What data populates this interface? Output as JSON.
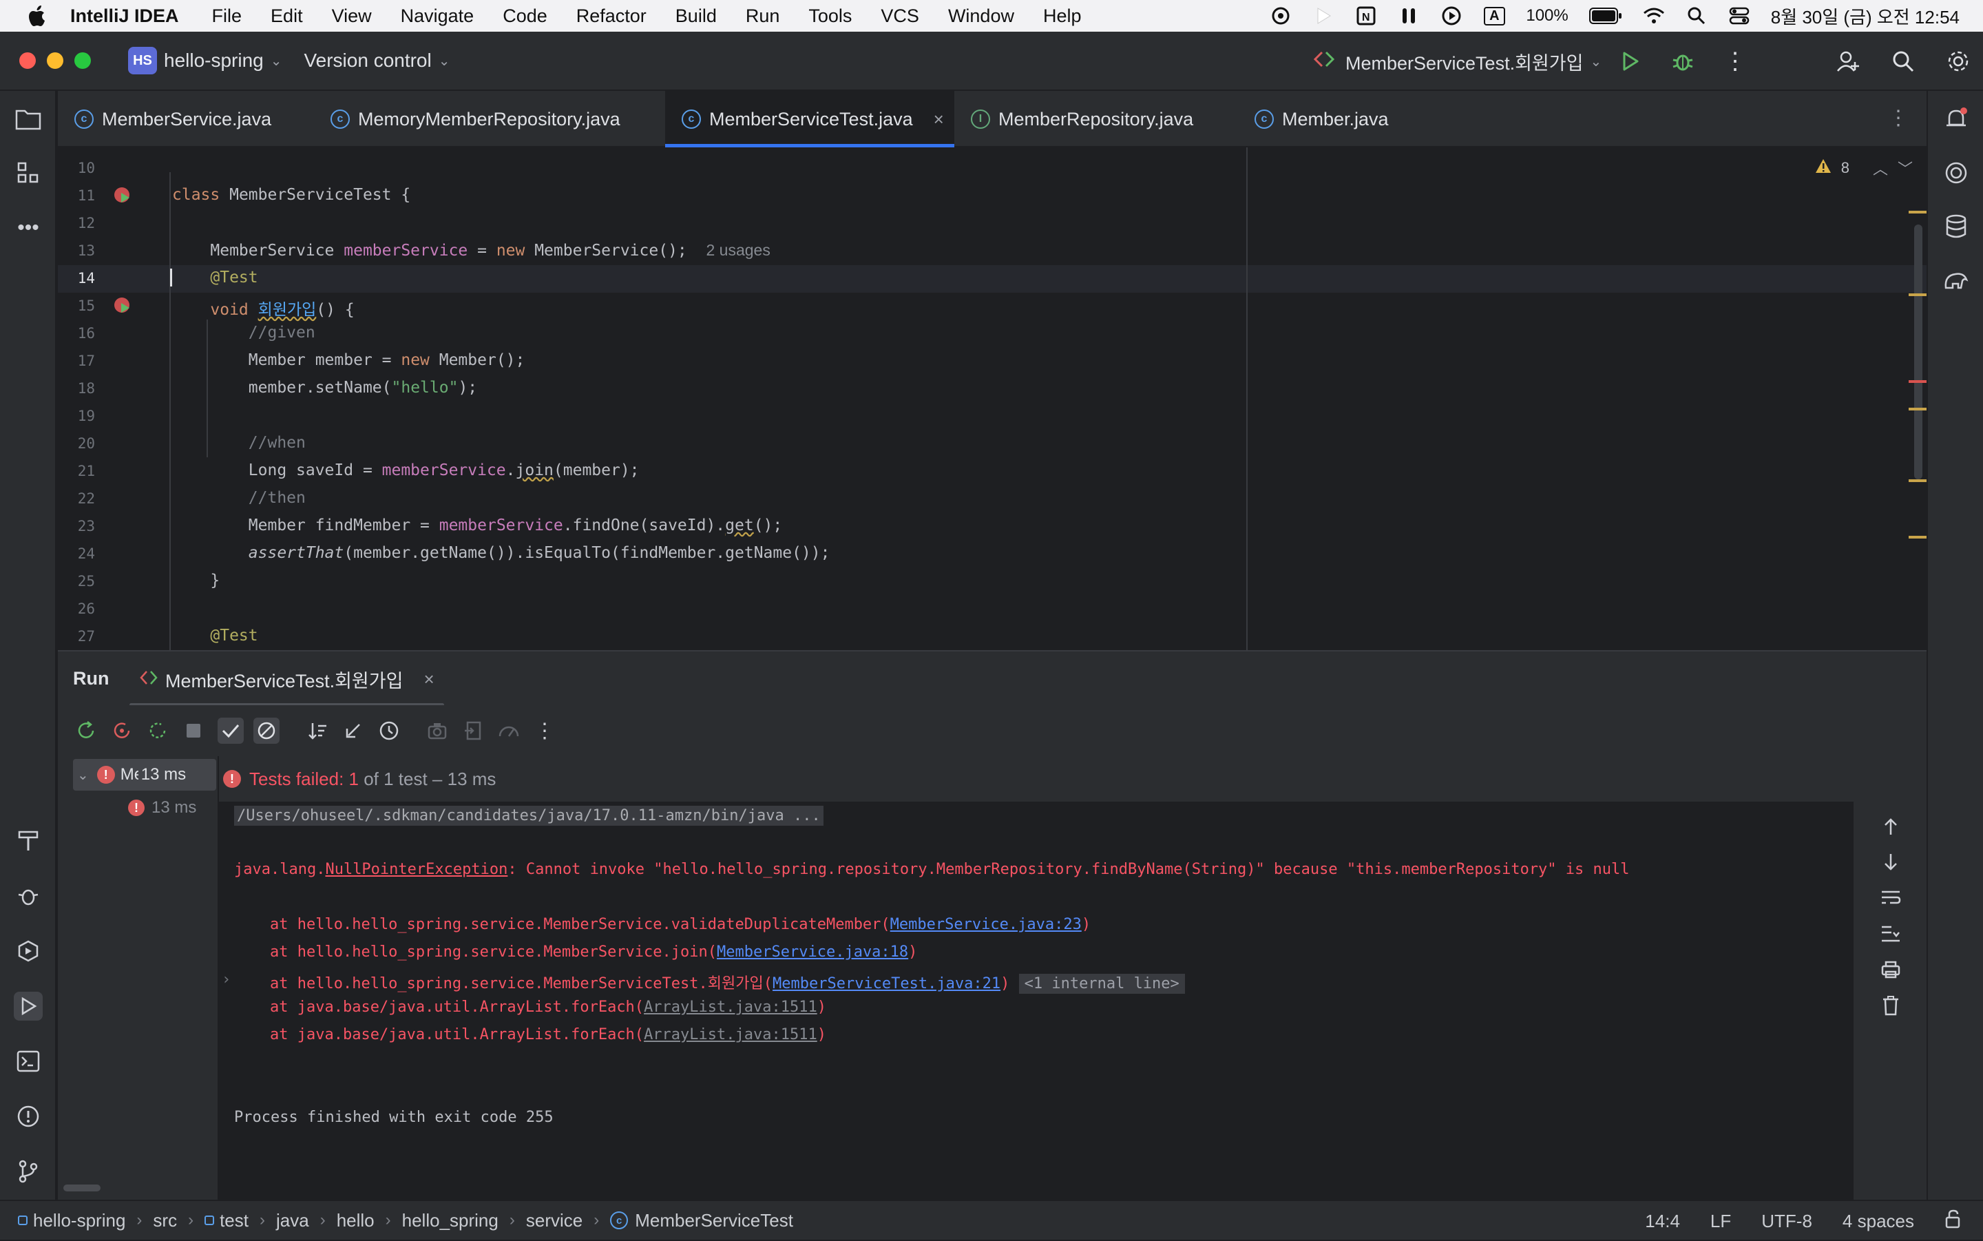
{
  "menubar": {
    "app_name": "IntelliJ IDEA",
    "items": [
      "File",
      "Edit",
      "View",
      "Navigate",
      "Code",
      "Refactor",
      "Build",
      "Run",
      "Tools",
      "VCS",
      "Window",
      "Help"
    ],
    "battery": "100%",
    "clock": "8월 30일 (금) 오전 12:54",
    "status_icons": [
      "chatgpt-icon",
      "play-icon",
      "notion-icon",
      "airpods-icon",
      "media-icon",
      "input-source-icon",
      "battery-icon",
      "wifi-icon",
      "spotlight-icon",
      "control-center-icon"
    ],
    "input_source_label": "A"
  },
  "titlebar": {
    "project_badge": "HS",
    "project_name": "hello-spring",
    "vcs_label": "Version control",
    "run_config": "MemberServiceTest.회원가입"
  },
  "tabs": [
    {
      "label": "MemberService.java",
      "kind": "class",
      "active": false
    },
    {
      "label": "MemoryMemberRepository.java",
      "kind": "class",
      "active": false
    },
    {
      "label": "MemberServiceTest.java",
      "kind": "class",
      "active": true
    },
    {
      "label": "MemberRepository.java",
      "kind": "interface",
      "active": false
    },
    {
      "label": "Member.java",
      "kind": "class",
      "active": false
    }
  ],
  "editor": {
    "problems_count": "8",
    "usages_hint": "2 usages",
    "current_line": 14,
    "line_numbers": [
      "10",
      "11",
      "12",
      "13",
      "14",
      "15",
      "16",
      "17",
      "18",
      "19",
      "20",
      "21",
      "22",
      "23",
      "24",
      "25",
      "26",
      "27"
    ]
  },
  "run_window": {
    "title": "Run",
    "tab_label": "MemberServiceTest.회원가입",
    "tree": {
      "root_label": "Me",
      "root_time": "13 ms",
      "child_time": "13 ms"
    },
    "summary_prefix": "Tests failed: ",
    "summary_failed": "1",
    "summary_suffix": " of 1 test – 13 ms",
    "console": {
      "cmd": "/Users/ohuseel/.sdkman/candidates/java/17.0.11-amzn/bin/java ...",
      "exception_class_prefix": "java.lang.",
      "exception_class_link": "NullPointerException",
      "exception_message": ": Cannot invoke \"hello.hello_spring.repository.MemberRepository.findByName(String)\" because \"this.memberRepository\" is null",
      "frames": [
        {
          "prefix": "at hello.hello_spring.service.MemberService.validateDuplicateMember(",
          "link": "MemberService.java:23",
          "suffix": ")",
          "style": "link"
        },
        {
          "prefix": "at hello.hello_spring.service.MemberService.join(",
          "link": "MemberService.java:18",
          "suffix": ")",
          "style": "link"
        },
        {
          "prefix": "at hello.hello_spring.service.MemberServiceTest.회원가입(",
          "link": "MemberServiceTest.java:21",
          "suffix": ")",
          "style": "link",
          "internal": "<1 internal line>"
        },
        {
          "prefix": "at java.base/java.util.ArrayList.forEach(",
          "link": "ArrayList.java:1511",
          "suffix": ")",
          "style": "gray"
        },
        {
          "prefix": "at java.base/java.util.ArrayList.forEach(",
          "link": "ArrayList.java:1511",
          "suffix": ")",
          "style": "gray"
        }
      ],
      "exit_message": "Process finished with exit code 255"
    }
  },
  "statusbar": {
    "breadcrumbs": [
      "hello-spring",
      "src",
      "test",
      "java",
      "hello",
      "hello_spring",
      "service",
      "MemberServiceTest"
    ],
    "position": "14:4",
    "line_sep": "LF",
    "encoding": "UTF-8",
    "indent": "4 spaces"
  },
  "colors": {
    "accent": "#3574f0",
    "error": "#f75464",
    "keyword": "#cf8e6d",
    "field": "#c77dbb",
    "string": "#6aab73"
  }
}
